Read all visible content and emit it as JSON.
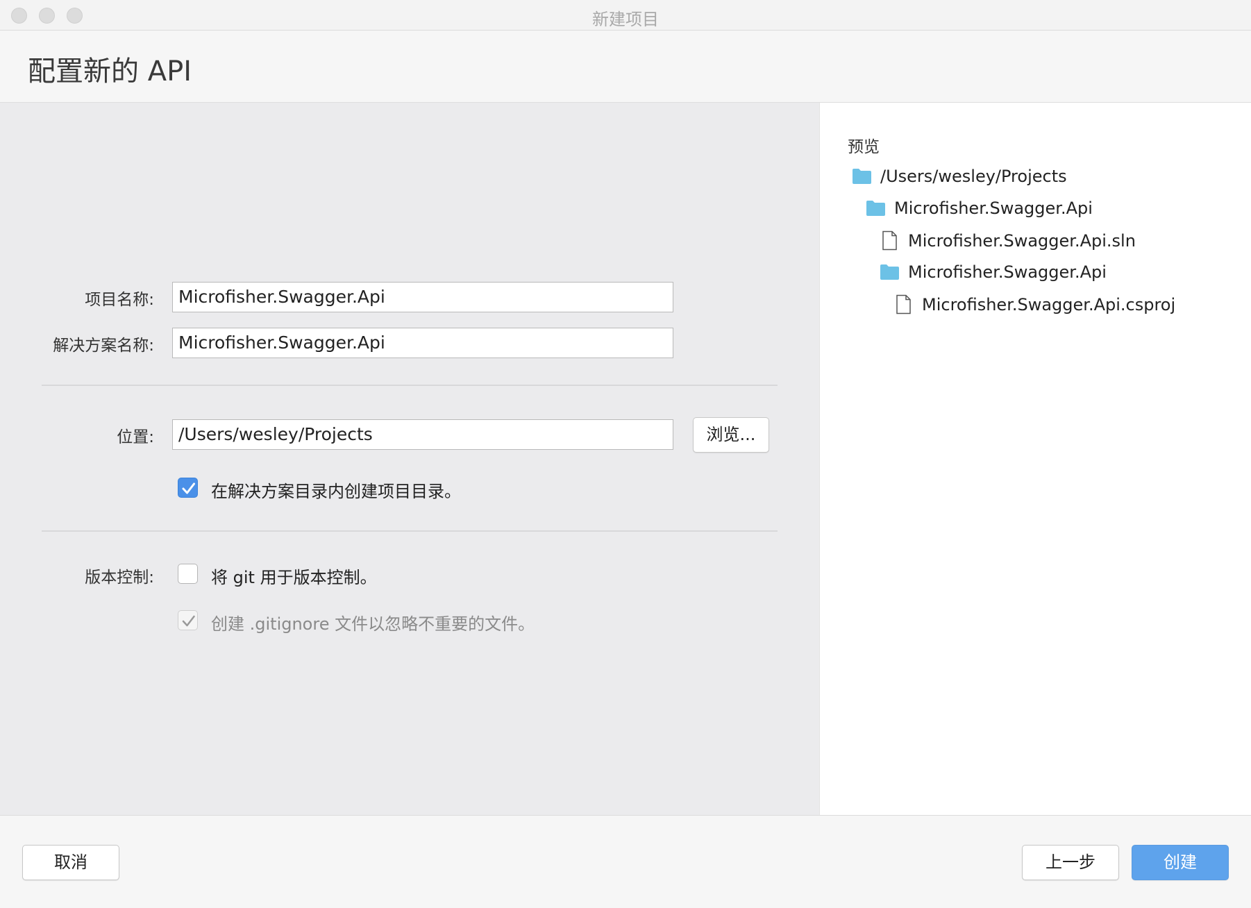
{
  "window": {
    "title": "新建项目"
  },
  "header": {
    "title": "配置新的 API"
  },
  "form": {
    "project_name_label": "项目名称:",
    "project_name_value": "Microfisher.Swagger.Api",
    "solution_name_label": "解决方案名称:",
    "solution_name_value": "Microfisher.Swagger.Api",
    "location_label": "位置:",
    "location_value": "/Users/wesley/Projects",
    "browse_label": "浏览...",
    "create_dir_label": "在解决方案目录内创建项目目录。",
    "create_dir_checked": true,
    "vcs_label": "版本控制:",
    "use_git_label": "将 git 用于版本控制。",
    "use_git_checked": false,
    "gitignore_label": "创建 .gitignore 文件以忽略不重要的文件。",
    "gitignore_checked": true
  },
  "preview": {
    "title": "预览",
    "items": [
      {
        "label": "/Users/wesley/Projects",
        "icon": "folder-icon"
      },
      {
        "label": "Microfisher.Swagger.Api",
        "icon": "folder-icon"
      },
      {
        "label": "Microfisher.Swagger.Api.sln",
        "icon": "file-icon"
      },
      {
        "label": "Microfisher.Swagger.Api",
        "icon": "folder-icon"
      },
      {
        "label": "Microfisher.Swagger.Api.csproj",
        "icon": "file-icon"
      }
    ]
  },
  "footer": {
    "cancel_label": "取消",
    "back_label": "上一步",
    "create_label": "创建"
  },
  "colors": {
    "accent": "#4a90e8",
    "primary_button": "#5ea3ec",
    "folder": "#6cc1e6"
  }
}
